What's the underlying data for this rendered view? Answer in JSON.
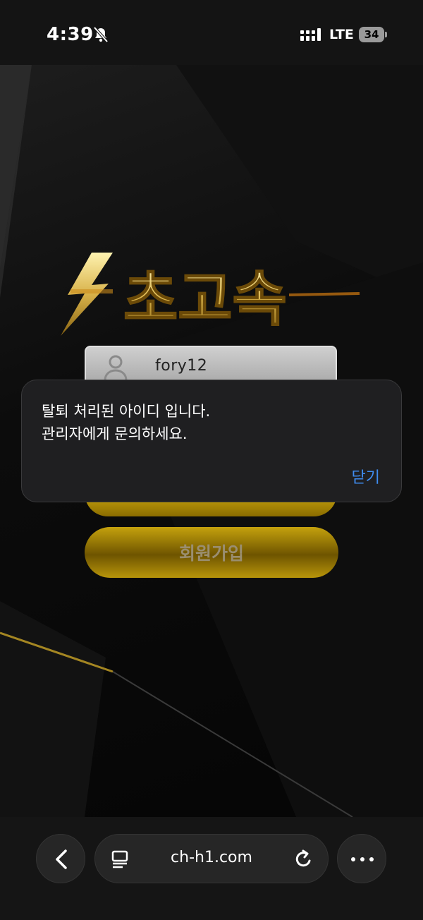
{
  "status_bar": {
    "time": "4:39",
    "network": "LTE",
    "battery": "34",
    "icons": [
      "bell-slash-icon",
      "signal-icon",
      "battery-icon"
    ]
  },
  "login": {
    "id_value": "fory12",
    "signup_label": "회원가입"
  },
  "alert": {
    "message_line1": "탈퇴 처리된 아이디 입니다.",
    "message_line2": "관리자에게 문의하세요.",
    "close_label": "닫기",
    "close_color": "#3f8cf0"
  },
  "browser": {
    "url": "ch-h1.com",
    "icons": [
      "back-icon",
      "reader-icon",
      "reload-icon",
      "more-icon"
    ]
  },
  "colors": {
    "gold": "#c39f0b",
    "background": "#000000"
  }
}
